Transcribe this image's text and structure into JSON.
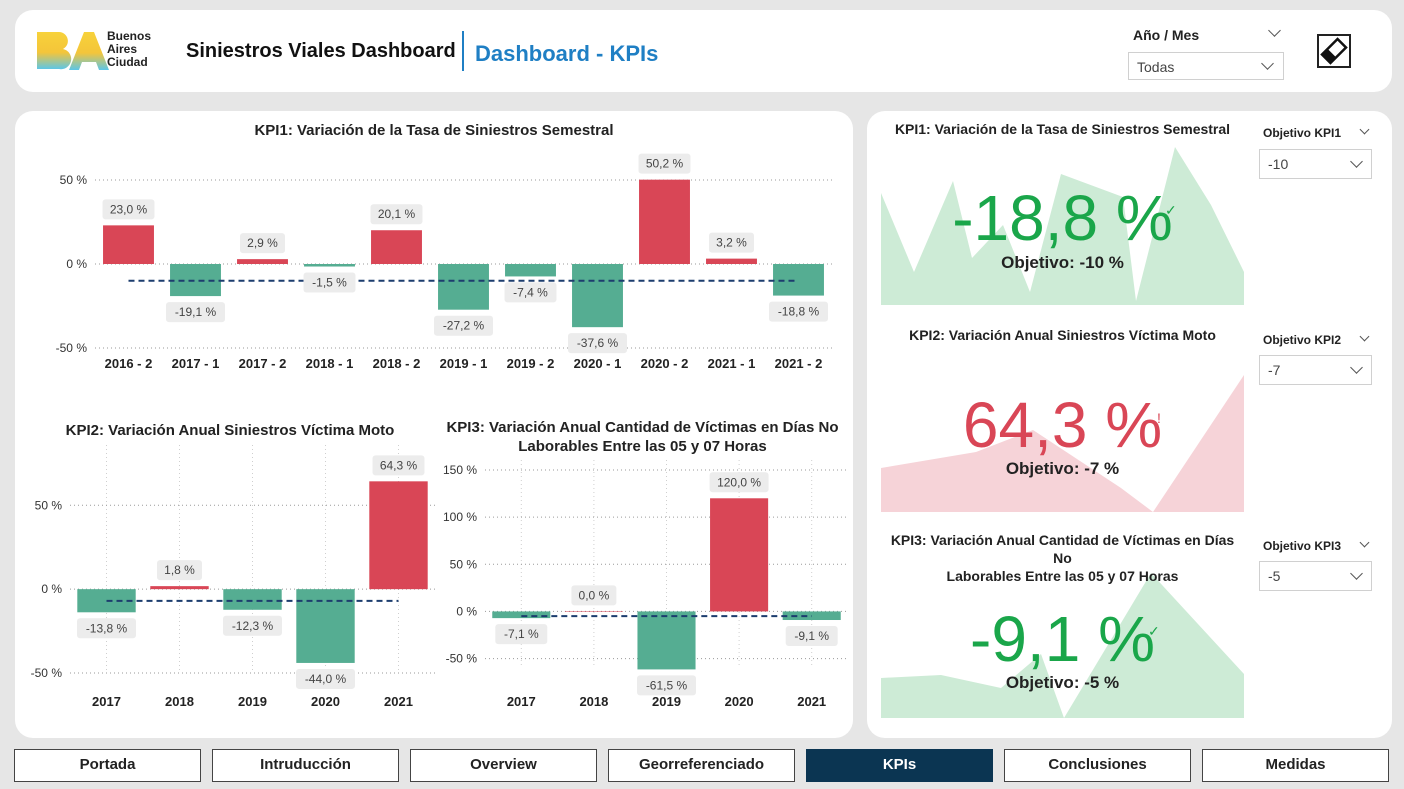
{
  "header": {
    "logo_lines": [
      "Buenos",
      "Aires",
      "Ciudad"
    ],
    "title": "Siniestros Viales Dashboard",
    "subtitle": "Dashboard - KPIs",
    "slicer_label": "Año / Mes",
    "slicer_value": "Todas",
    "icon": "eraser-icon"
  },
  "charts": {
    "kpi1": {
      "title": "KPI1: Variación de la Tasa de Siniestros Semestral",
      "chart_data": {
        "type": "bar",
        "categories": [
          "2016 - 2",
          "2017 - 1",
          "2017 - 2",
          "2018 - 1",
          "2018 - 2",
          "2019 - 1",
          "2019 - 2",
          "2020 - 1",
          "2020 - 2",
          "2021 - 1",
          "2021 - 2"
        ],
        "values": [
          23.0,
          -19.1,
          2.9,
          -1.5,
          20.1,
          -27.2,
          -7.4,
          -37.6,
          50.2,
          3.2,
          -18.8
        ],
        "labels": [
          "23,0 %",
          "-19,1 %",
          "2,9 %",
          "-1,5 %",
          "20,1 %",
          "-27,2 %",
          "-7,4 %",
          "-37,6 %",
          "50,2 %",
          "3,2 %",
          "-18,8 %"
        ],
        "ylim": [
          -50,
          50
        ],
        "yticks": [
          50,
          0,
          -50
        ],
        "ytick_labels": [
          "50 %",
          "0 %",
          "-50 %"
        ],
        "target": -10,
        "colors": {
          "positive": "#d94656",
          "negative": "#55ad92",
          "target": "#1c3d6e"
        }
      }
    },
    "kpi2": {
      "title": "KPI2: Variación Anual Siniestros Víctima Moto",
      "chart_data": {
        "type": "bar",
        "categories": [
          "2017",
          "2018",
          "2019",
          "2020",
          "2021"
        ],
        "values": [
          -13.8,
          1.8,
          -12.3,
          -44.0,
          64.3
        ],
        "labels": [
          "-13,8 %",
          "1,8 %",
          "-12,3 %",
          "-44,0 %",
          "64,3 %"
        ],
        "ylim": [
          -50,
          80
        ],
        "yticks": [
          50,
          0,
          -50
        ],
        "ytick_labels": [
          "50 %",
          "0 %",
          "-50 %"
        ],
        "target": -7,
        "colors": {
          "positive": "#d94656",
          "negative": "#55ad92",
          "target": "#1c3d6e"
        }
      }
    },
    "kpi3": {
      "title_lines": [
        "KPI3: Variación Anual Cantidad de Víctimas en Días No",
        "Laborables Entre las 05 y 07 Horas"
      ],
      "chart_data": {
        "type": "bar",
        "categories": [
          "2017",
          "2018",
          "2019",
          "2020",
          "2021"
        ],
        "values": [
          -7.1,
          0.0,
          -61.5,
          120.0,
          -9.1
        ],
        "labels": [
          "-7,1 %",
          "0,0 %",
          "-61,5 %",
          "120,0 %",
          "-9,1 %"
        ],
        "ylim": [
          -60,
          150
        ],
        "yticks": [
          150,
          100,
          50,
          0,
          -50
        ],
        "ytick_labels": [
          "150 %",
          "100 %",
          "50 %",
          "0 %",
          "-50 %"
        ],
        "target": -5,
        "colors": {
          "positive": "#d94656",
          "negative": "#55ad92",
          "target": "#1c3d6e"
        }
      }
    }
  },
  "cards": [
    {
      "title_lines": [
        "KPI1: Variación de la Tasa de Siniestros Semestral"
      ],
      "value": "-18,8 %",
      "mark": "✓",
      "objective": "Objetivo: -10 %",
      "status": "good",
      "slicer_label": "Objetivo KPI1",
      "slicer_value": "-10"
    },
    {
      "title_lines": [
        "KPI2: Variación Anual Siniestros Víctima Moto"
      ],
      "value": "64,3 %",
      "mark": "!",
      "objective": "Objetivo: -7 %",
      "status": "bad",
      "slicer_label": "Objetivo KPI2",
      "slicer_value": "-7"
    },
    {
      "title_lines": [
        "KPI3: Variación Anual Cantidad de Víctimas en Días No",
        "Laborables Entre las 05 y 07 Horas"
      ],
      "value": "-9,1 %",
      "mark": "✓",
      "objective": "Objetivo: -5 %",
      "status": "good",
      "slicer_label": "Objetivo KPI3",
      "slicer_value": "-5"
    }
  ],
  "colors": {
    "good_text": "#1aa64a",
    "good_fill": "#cdebd6",
    "bad_text": "#d94656",
    "bad_fill": "#f6d3d8",
    "active_tab": "#0b3552"
  },
  "nav": {
    "items": [
      "Portada",
      "Intruducción",
      "Overview",
      "Georreferenciado",
      "KPIs",
      "Conclusiones",
      "Medidas"
    ],
    "active": "KPIs"
  }
}
